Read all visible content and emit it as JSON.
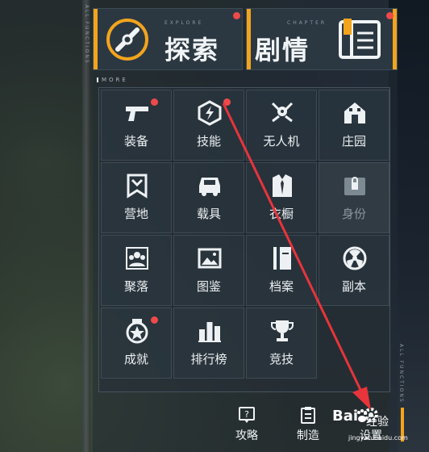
{
  "top_buttons": [
    {
      "sub": "EXPLORE",
      "label": "探索",
      "badge": true
    },
    {
      "sub": "CHAPTER",
      "label": "剧情",
      "badge": true
    }
  ],
  "section_label": "MORE",
  "grid_items": [
    {
      "label": "装备",
      "icon": "pistol-icon",
      "badge": true
    },
    {
      "label": "技能",
      "icon": "skill-bolt-icon",
      "badge": true
    },
    {
      "label": "无人机",
      "icon": "drone-icon",
      "badge": false
    },
    {
      "label": "庄园",
      "icon": "house-icon",
      "badge": false
    },
    {
      "label": "营地",
      "icon": "banner-icon",
      "badge": false
    },
    {
      "label": "载具",
      "icon": "vehicle-icon",
      "badge": false
    },
    {
      "label": "衣橱",
      "icon": "suit-icon",
      "badge": false
    },
    {
      "label": "身份",
      "icon": "lock-icon",
      "badge": false,
      "locked": true
    },
    {
      "label": "聚落",
      "icon": "group-icon",
      "badge": false
    },
    {
      "label": "图鉴",
      "icon": "gallery-icon",
      "badge": false
    },
    {
      "label": "档案",
      "icon": "archive-icon",
      "badge": false
    },
    {
      "label": "副本",
      "icon": "radiation-icon",
      "badge": false
    },
    {
      "label": "成就",
      "icon": "medal-icon",
      "badge": true
    },
    {
      "label": "排行榜",
      "icon": "ranking-icon",
      "badge": false
    },
    {
      "label": "竞技",
      "icon": "trophy-icon",
      "badge": false
    }
  ],
  "bottom_bar": [
    {
      "label": "攻略",
      "icon": "guide-icon"
    },
    {
      "label": "制造",
      "icon": "craft-icon"
    },
    {
      "label": "设置",
      "icon": "gear-icon"
    }
  ],
  "side_tags": [
    "ALL FUNCTIONS",
    "ALL FUNCTIONS"
  ],
  "watermark": {
    "brand": "Bai",
    "brand2": "经验",
    "url": "jingyan.baidu.com"
  },
  "colors": {
    "accent": "#f3a41d",
    "badge": "#ee4a4a",
    "arrow": "#e8343b"
  }
}
